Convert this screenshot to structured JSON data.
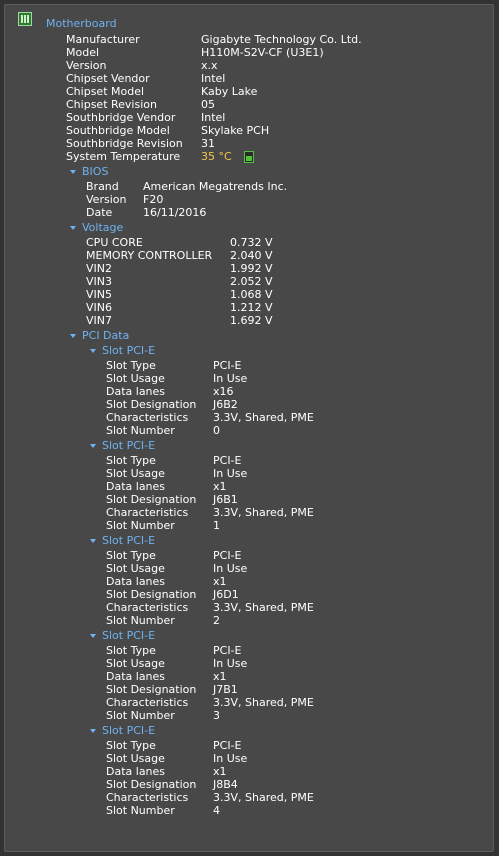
{
  "title": "Motherboard",
  "motherboard": [
    {
      "label": "Manufacturer",
      "value": "Gigabyte Technology Co. Ltd."
    },
    {
      "label": "Model",
      "value": "H110M-S2V-CF (U3E1)"
    },
    {
      "label": "Version",
      "value": "x.x"
    },
    {
      "label": "Chipset Vendor",
      "value": "Intel"
    },
    {
      "label": "Chipset Model",
      "value": "Kaby Lake"
    },
    {
      "label": "Chipset Revision",
      "value": "05"
    },
    {
      "label": "Southbridge Vendor",
      "value": "Intel"
    },
    {
      "label": "Southbridge Model",
      "value": "Skylake PCH"
    },
    {
      "label": "Southbridge Revision",
      "value": "31"
    }
  ],
  "temperature": {
    "label": "System Temperature",
    "value": "35 °C",
    "color": "#f2c94c"
  },
  "bios": {
    "header": "BIOS",
    "rows": [
      {
        "label": "Brand",
        "value": "American Megatrends Inc."
      },
      {
        "label": "Version",
        "value": "F20"
      },
      {
        "label": "Date",
        "value": "16/11/2016"
      }
    ]
  },
  "voltage": {
    "header": "Voltage",
    "rows": [
      {
        "label": "CPU CORE",
        "value": "0.732 V"
      },
      {
        "label": "MEMORY CONTROLLER",
        "value": "2.040 V"
      },
      {
        "label": "VIN2",
        "value": "1.992 V"
      },
      {
        "label": "VIN3",
        "value": "2.052 V"
      },
      {
        "label": "VIN5",
        "value": "1.068 V"
      },
      {
        "label": "VIN6",
        "value": "1.212 V"
      },
      {
        "label": "VIN7",
        "value": "1.692 V"
      }
    ]
  },
  "pci": {
    "header": "PCI Data",
    "slots": [
      {
        "header": "Slot PCI-E",
        "rows": [
          {
            "label": "Slot Type",
            "value": "PCI-E"
          },
          {
            "label": "Slot Usage",
            "value": "In Use"
          },
          {
            "label": "Data lanes",
            "value": "x16"
          },
          {
            "label": "Slot Designation",
            "value": "J6B2"
          },
          {
            "label": "Characteristics",
            "value": "3.3V, Shared, PME"
          },
          {
            "label": "Slot Number",
            "value": "0"
          }
        ]
      },
      {
        "header": "Slot PCI-E",
        "rows": [
          {
            "label": "Slot Type",
            "value": "PCI-E"
          },
          {
            "label": "Slot Usage",
            "value": "In Use"
          },
          {
            "label": "Data lanes",
            "value": "x1"
          },
          {
            "label": "Slot Designation",
            "value": "J6B1"
          },
          {
            "label": "Characteristics",
            "value": "3.3V, Shared, PME"
          },
          {
            "label": "Slot Number",
            "value": "1"
          }
        ]
      },
      {
        "header": "Slot PCI-E",
        "rows": [
          {
            "label": "Slot Type",
            "value": "PCI-E"
          },
          {
            "label": "Slot Usage",
            "value": "In Use"
          },
          {
            "label": "Data lanes",
            "value": "x1"
          },
          {
            "label": "Slot Designation",
            "value": "J6D1"
          },
          {
            "label": "Characteristics",
            "value": "3.3V, Shared, PME"
          },
          {
            "label": "Slot Number",
            "value": "2"
          }
        ]
      },
      {
        "header": "Slot PCI-E",
        "rows": [
          {
            "label": "Slot Type",
            "value": "PCI-E"
          },
          {
            "label": "Slot Usage",
            "value": "In Use"
          },
          {
            "label": "Data lanes",
            "value": "x1"
          },
          {
            "label": "Slot Designation",
            "value": "J7B1"
          },
          {
            "label": "Characteristics",
            "value": "3.3V, Shared, PME"
          },
          {
            "label": "Slot Number",
            "value": "3"
          }
        ]
      },
      {
        "header": "Slot PCI-E",
        "rows": [
          {
            "label": "Slot Type",
            "value": "PCI-E"
          },
          {
            "label": "Slot Usage",
            "value": "In Use"
          },
          {
            "label": "Data lanes",
            "value": "x1"
          },
          {
            "label": "Slot Designation",
            "value": "J8B4"
          },
          {
            "label": "Characteristics",
            "value": "3.3V, Shared, PME"
          },
          {
            "label": "Slot Number",
            "value": "4"
          }
        ]
      }
    ]
  }
}
